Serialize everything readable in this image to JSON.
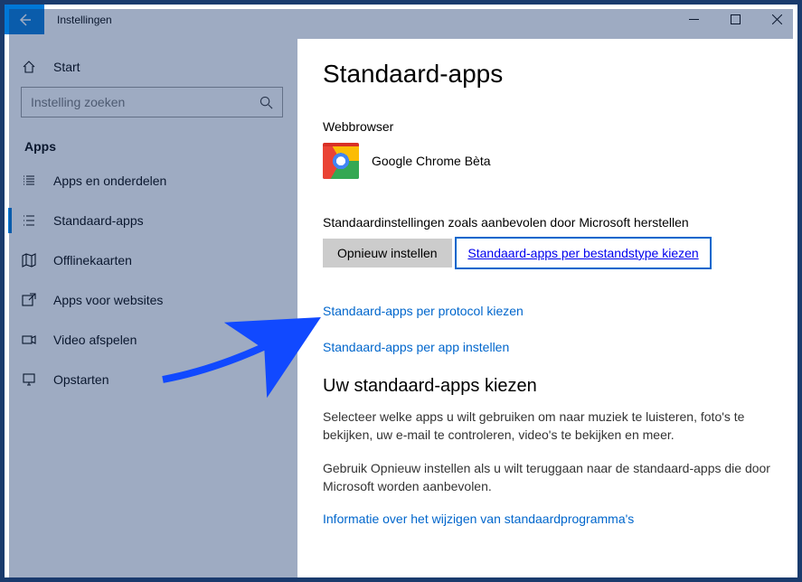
{
  "titlebar": {
    "app_title": "Instellingen"
  },
  "sidebar": {
    "home_label": "Start",
    "search_placeholder": "Instelling zoeken",
    "section": "Apps",
    "items": [
      {
        "label": "Apps en onderdelen"
      },
      {
        "label": "Standaard-apps"
      },
      {
        "label": "Offlinekaarten"
      },
      {
        "label": "Apps voor websites"
      },
      {
        "label": "Video afspelen"
      },
      {
        "label": "Opstarten"
      }
    ],
    "active_index": 1
  },
  "main": {
    "heading": "Standaard-apps",
    "browser_label": "Webbrowser",
    "browser_app": "Google Chrome Bèta",
    "restore_text": "Standaardinstellingen zoals aanbevolen door Microsoft herstellen",
    "reset_button": "Opnieuw instellen",
    "links": {
      "by_filetype": "Standaard-apps per bestandstype kiezen",
      "by_protocol": "Standaard-apps per protocol kiezen",
      "by_app": "Standaard-apps per app instellen"
    },
    "choose_heading": "Uw standaard-apps kiezen",
    "choose_para1": "Selecteer welke apps u wilt gebruiken om naar muziek te luisteren, foto's te bekijken, uw e-mail te controleren, video's te bekijken en meer.",
    "choose_para2": "Gebruik Opnieuw instellen als u wilt teruggaan naar de standaard-apps die door Microsoft worden aanbevolen.",
    "info_link": "Informatie over het wijzigen van standaardprogramma's"
  }
}
